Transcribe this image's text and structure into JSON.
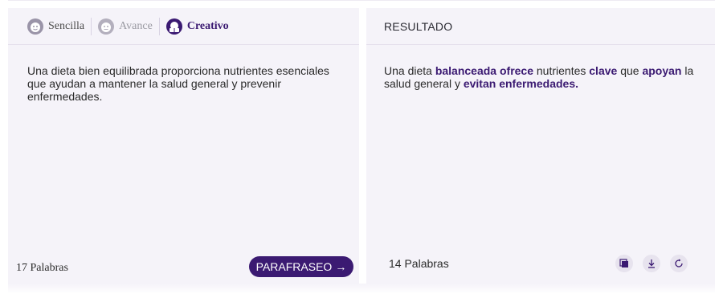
{
  "modes": [
    {
      "label": "Sencilla",
      "icon": "smile-face-icon",
      "state": "normal"
    },
    {
      "label": "Avance",
      "icon": "neutral-face-icon",
      "state": "dim"
    },
    {
      "label": "Creativo",
      "icon": "reader-face-icon",
      "state": "active"
    }
  ],
  "input": {
    "text": "Una dieta bien equilibrada proporciona nutrientes esenciales que ayudan a mantener la salud general y prevenir enfermedades.",
    "word_count": "17 Palabras",
    "button_label": "PARAFRASEO"
  },
  "result": {
    "title": "RESULTADO",
    "segments": [
      {
        "text": "Una dieta ",
        "bold": false
      },
      {
        "text": "balanceada ofrece",
        "bold": true
      },
      {
        "text": " nutrientes ",
        "bold": false
      },
      {
        "text": "clave",
        "bold": true
      },
      {
        "text": " que ",
        "bold": false
      },
      {
        "text": "apoyan",
        "bold": true
      },
      {
        "text": " la salud general y ",
        "bold": false
      },
      {
        "text": "evitan enfermedades.",
        "bold": true
      }
    ],
    "word_count": "14 Palabras",
    "actions": [
      "copy-icon",
      "download-icon",
      "refresh-icon"
    ]
  },
  "colors": {
    "accent": "#3b1a72",
    "panel": "#f5f3f9"
  }
}
